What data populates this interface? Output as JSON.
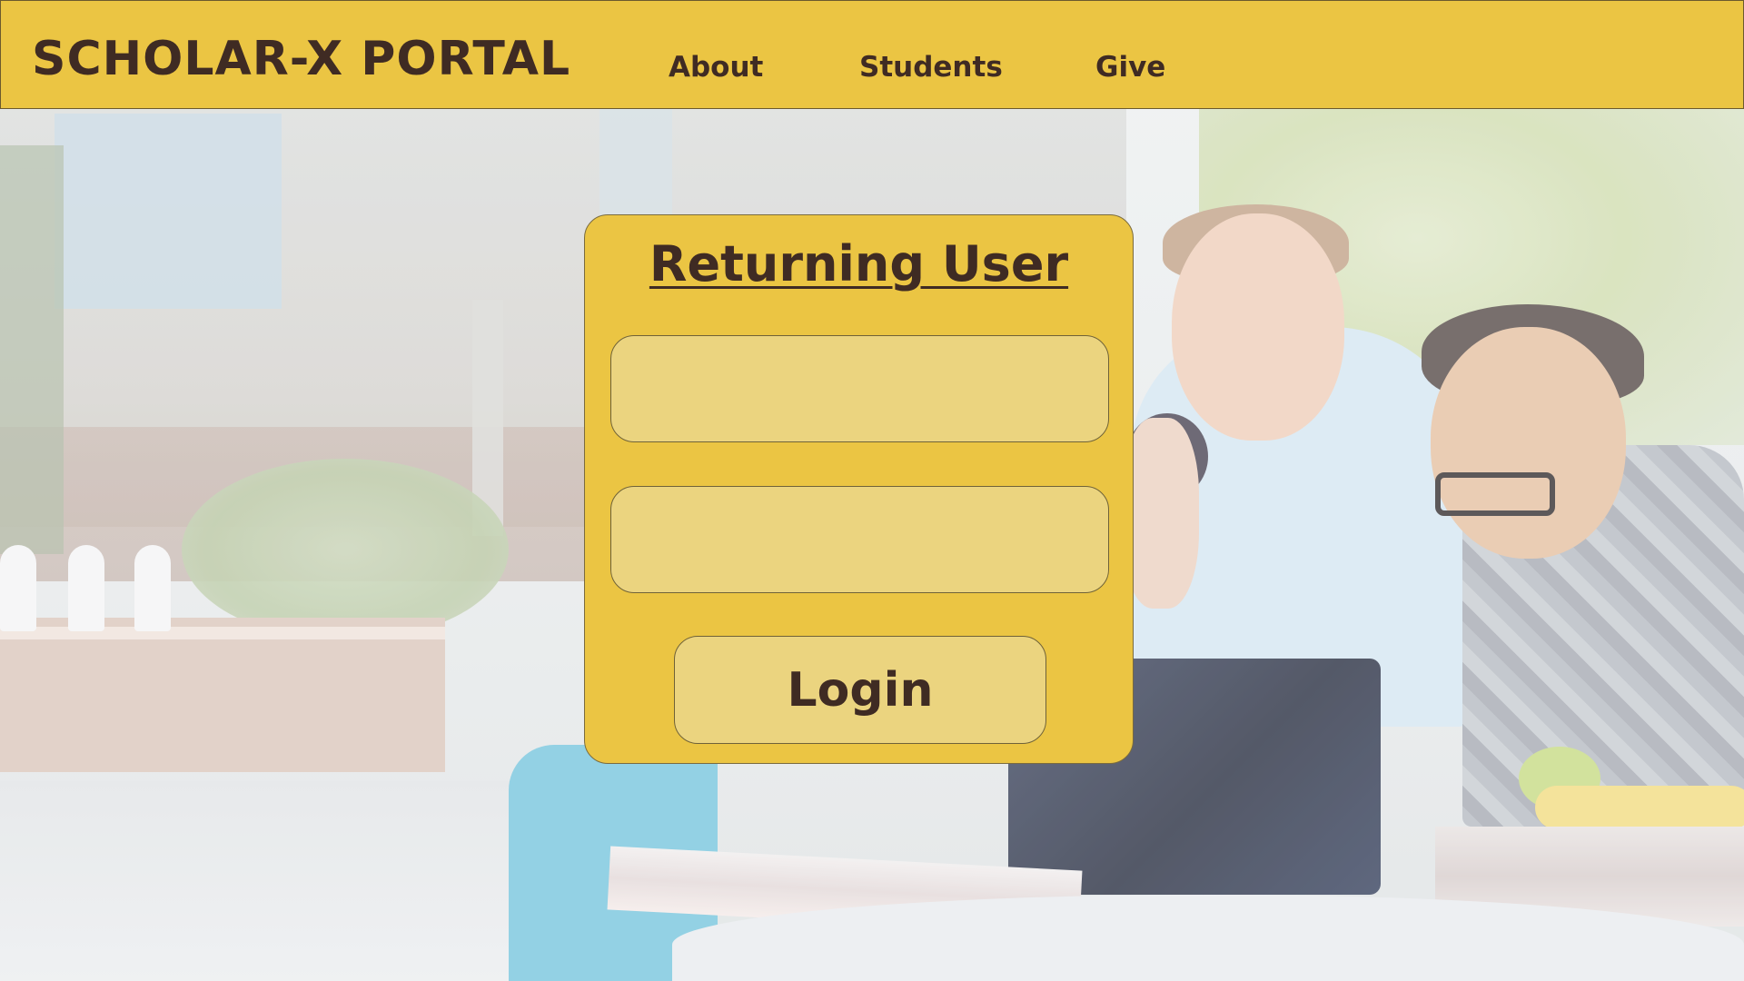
{
  "header": {
    "brand": "SCHOLAR-X PORTAL",
    "nav": [
      {
        "label": "About"
      },
      {
        "label": "Students"
      },
      {
        "label": "Give"
      }
    ]
  },
  "login": {
    "title": "Returning User",
    "username": {
      "value": "",
      "placeholder": ""
    },
    "password": {
      "value": "",
      "placeholder": ""
    },
    "submit_label": "Login"
  },
  "background": {
    "description_icon": "students-laptop-photo"
  },
  "colors": {
    "accent": "#ebc543",
    "field_fill": "#ebd47f",
    "text": "#3f2b23"
  }
}
